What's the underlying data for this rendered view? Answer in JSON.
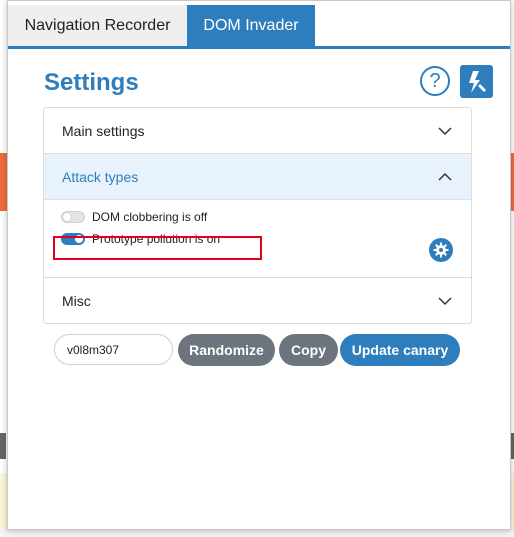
{
  "tabs": [
    {
      "label": "Navigation Recorder",
      "active": false
    },
    {
      "label": "DOM Invader",
      "active": true
    }
  ],
  "settings": {
    "title": "Settings",
    "help_glyph": "?",
    "help_icon": "question-icon",
    "tool_icon": "burp-hammer-icon"
  },
  "accordion": {
    "main": {
      "label": "Main settings",
      "expanded": false
    },
    "attack": {
      "label": "Attack types",
      "expanded": true
    },
    "misc": {
      "label": "Misc",
      "expanded": false
    }
  },
  "attack_types": {
    "dom_clobbering": {
      "label": "DOM clobbering is off",
      "enabled": false
    },
    "prototype_pollution": {
      "label": "Prototype pollution is on",
      "enabled": true
    }
  },
  "canary": {
    "value": "v0l8m307",
    "randomize_label": "Randomize",
    "copy_label": "Copy",
    "update_label": "Update canary"
  },
  "colors": {
    "accent": "#2e7dbc",
    "button_gray": "#6c757d",
    "highlight_red": "#e3001b"
  }
}
